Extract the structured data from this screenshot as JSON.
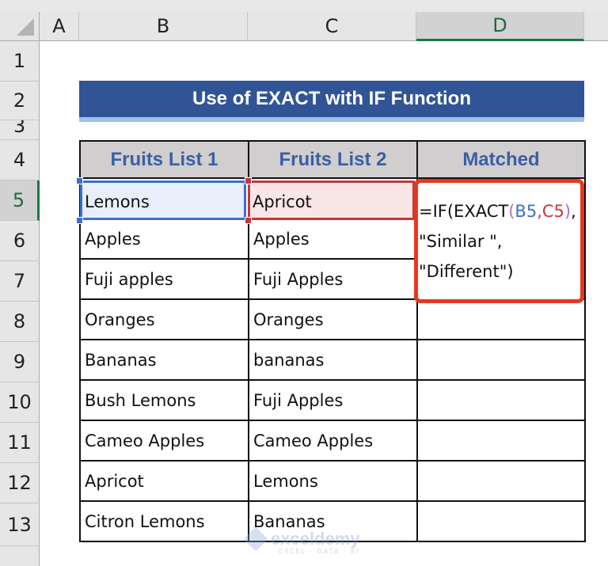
{
  "sheet": {
    "columns": [
      "A",
      "B",
      "C",
      "D"
    ],
    "selected_column": "D",
    "rows": [
      "1",
      "2",
      "3",
      "4",
      "5",
      "6",
      "7",
      "8",
      "9",
      "10",
      "11",
      "12",
      "13"
    ],
    "selected_row": "5"
  },
  "title": "Use of EXACT with IF Function",
  "table": {
    "headers": [
      "Fruits List 1",
      "Fruits List 2",
      "Matched"
    ],
    "rows": [
      {
        "list1": "Lemons",
        "list2": "Apricot",
        "matched": ""
      },
      {
        "list1": "Apples",
        "list2": "Apples",
        "matched": ""
      },
      {
        "list1": "Fuji apples",
        "list2": "Fuji Apples",
        "matched": ""
      },
      {
        "list1": "Oranges",
        "list2": "Oranges",
        "matched": ""
      },
      {
        "list1": "Bananas",
        "list2": "bananas",
        "matched": ""
      },
      {
        "list1": "Bush Lemons",
        "list2": "Fuji Apples",
        "matched": ""
      },
      {
        "list1": "Cameo Apples",
        "list2": "Cameo Apples",
        "matched": ""
      },
      {
        "list1": "Apricot",
        "list2": "Lemons",
        "matched": ""
      },
      {
        "list1": "Citron Lemons",
        "list2": "Bananas",
        "matched": ""
      }
    ]
  },
  "formula": {
    "cell": "D5",
    "prefix": "=IF(EXACT",
    "open_paren": "(",
    "ref1": "B5",
    "comma": ",",
    "ref2": "C5",
    "close_paren": ")",
    "trail": ",",
    "line2": "\"Similar \",",
    "line3": "\"Different\")"
  },
  "colors": {
    "title_bg": "#305496",
    "header_bg": "#d0cece",
    "header_text": "#3a5fa5",
    "ref1_color": "#3b6fd0",
    "ref2_color": "#c9353f",
    "highlight_border": "#e8381c",
    "selection_green": "#217346"
  },
  "watermark": {
    "name": "exceldemy",
    "tagline": "EXCEL · DATA · BI"
  }
}
